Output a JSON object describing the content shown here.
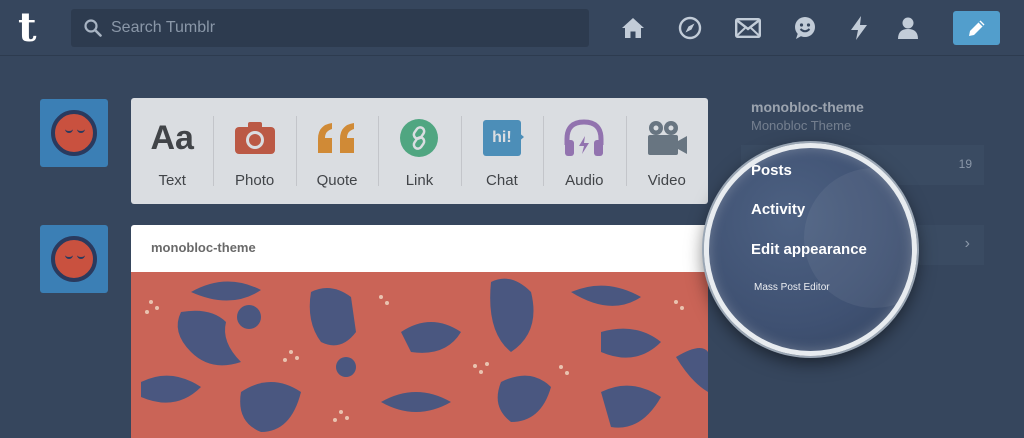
{
  "app": {
    "logo_letter": "t"
  },
  "search": {
    "placeholder": "Search Tumblr"
  },
  "nav": [
    {
      "icon": "home-icon"
    },
    {
      "icon": "explore-icon"
    },
    {
      "icon": "inbox-icon"
    },
    {
      "icon": "messaging-icon"
    },
    {
      "icon": "activity-icon"
    },
    {
      "icon": "account-icon"
    }
  ],
  "compose": {
    "icon": "pencil-icon"
  },
  "post_types": [
    {
      "label": "Text",
      "glyph": "Aa",
      "color": "#444444"
    },
    {
      "label": "Photo",
      "color": "#d95e40"
    },
    {
      "label": "Quote",
      "color": "#f2992e"
    },
    {
      "label": "Link",
      "color": "#56bc8a"
    },
    {
      "label": "Chat",
      "glyph": "hi!",
      "color": "#529ecc"
    },
    {
      "label": "Audio",
      "color": "#a77dc2"
    },
    {
      "label": "Video",
      "color": "#748089"
    }
  ],
  "post": {
    "blog_name": "monobloc-theme"
  },
  "sidebar": {
    "blog_name": "monobloc-theme",
    "blog_title": "Monobloc Theme",
    "items": [
      {
        "label": "Posts",
        "count": "19"
      },
      {
        "label": "Activity"
      },
      {
        "label": "Edit appearance"
      },
      {
        "label": "Mass Post Editor"
      }
    ]
  },
  "colors": {
    "background": "#36465d",
    "accent": "#529ecc",
    "avatar_bg": "#3b7fb5",
    "post_image": "#c14a3a"
  }
}
